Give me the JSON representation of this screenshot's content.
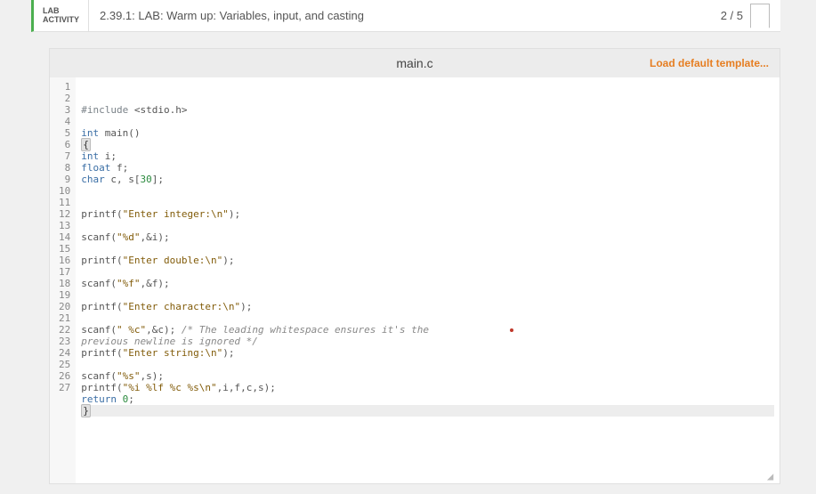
{
  "header": {
    "lab_label_line1": "LAB",
    "lab_label_line2": "ACTIVITY",
    "title": "2.39.1: LAB: Warm up: Variables, input, and casting",
    "score": "2 / 5"
  },
  "editor": {
    "filename": "main.c",
    "load_template_label": "Load default template...",
    "marker": {
      "line": 22,
      "col": 73
    },
    "lines": [
      {
        "n": 1,
        "tokens": [
          [
            "pp",
            "#include "
          ],
          [
            "pun",
            "<stdio.h>"
          ]
        ]
      },
      {
        "n": 2,
        "tokens": []
      },
      {
        "n": 3,
        "tokens": [
          [
            "typ",
            "int "
          ],
          [
            "fn",
            "main"
          ],
          [
            "pun",
            "()"
          ]
        ]
      },
      {
        "n": 4,
        "tokens": [
          [
            "brk",
            "{"
          ]
        ]
      },
      {
        "n": 5,
        "tokens": [
          [
            "typ",
            "int "
          ],
          [
            "fn",
            "i"
          ],
          [
            "pun",
            ";"
          ]
        ]
      },
      {
        "n": 6,
        "tokens": [
          [
            "typ",
            "float "
          ],
          [
            "fn",
            "f"
          ],
          [
            "pun",
            ";"
          ]
        ]
      },
      {
        "n": 7,
        "tokens": [
          [
            "typ",
            "char "
          ],
          [
            "fn",
            "c"
          ],
          [
            "pun",
            ", "
          ],
          [
            "fn",
            "s"
          ],
          [
            "pun",
            "["
          ],
          [
            "num",
            "30"
          ],
          [
            "pun",
            "];"
          ]
        ]
      },
      {
        "n": 8,
        "tokens": []
      },
      {
        "n": 9,
        "tokens": []
      },
      {
        "n": 10,
        "tokens": [
          [
            "fn",
            "printf"
          ],
          [
            "pun",
            "("
          ],
          [
            "str",
            "\"Enter integer:\\n\""
          ],
          [
            "pun",
            ");"
          ]
        ]
      },
      {
        "n": 11,
        "tokens": []
      },
      {
        "n": 12,
        "tokens": [
          [
            "fn",
            "scanf"
          ],
          [
            "pun",
            "("
          ],
          [
            "str",
            "\"%d\""
          ],
          [
            "pun",
            ",&"
          ],
          [
            "fn",
            "i"
          ],
          [
            "pun",
            ");"
          ]
        ]
      },
      {
        "n": 13,
        "tokens": []
      },
      {
        "n": 14,
        "tokens": [
          [
            "fn",
            "printf"
          ],
          [
            "pun",
            "("
          ],
          [
            "str",
            "\"Enter double:\\n\""
          ],
          [
            "pun",
            ");"
          ]
        ]
      },
      {
        "n": 15,
        "tokens": []
      },
      {
        "n": 16,
        "tokens": [
          [
            "fn",
            "scanf"
          ],
          [
            "pun",
            "("
          ],
          [
            "str",
            "\"%f\""
          ],
          [
            "pun",
            ",&"
          ],
          [
            "fn",
            "f"
          ],
          [
            "pun",
            ");"
          ]
        ]
      },
      {
        "n": 17,
        "tokens": []
      },
      {
        "n": 18,
        "tokens": [
          [
            "fn",
            "printf"
          ],
          [
            "pun",
            "("
          ],
          [
            "str",
            "\"Enter character:\\n\""
          ],
          [
            "pun",
            ");"
          ]
        ]
      },
      {
        "n": 19,
        "tokens": []
      },
      {
        "n": 20,
        "tokens": [
          [
            "fn",
            "scanf"
          ],
          [
            "pun",
            "("
          ],
          [
            "str",
            "\" %c\""
          ],
          [
            "pun",
            ",&"
          ],
          [
            "fn",
            "c"
          ],
          [
            "pun",
            "); "
          ],
          [
            "cmt",
            "/* The leading whitespace ensures it's the"
          ]
        ]
      },
      {
        "n": 21,
        "tokens": [
          [
            "cmt",
            "previous newline is ignored */"
          ]
        ]
      },
      {
        "n": 22,
        "tokens": [
          [
            "fn",
            "printf"
          ],
          [
            "pun",
            "("
          ],
          [
            "str",
            "\"Enter string:\\n\""
          ],
          [
            "pun",
            ");"
          ]
        ]
      },
      {
        "n": 23,
        "tokens": []
      },
      {
        "n": 24,
        "tokens": [
          [
            "fn",
            "scanf"
          ],
          [
            "pun",
            "("
          ],
          [
            "str",
            "\"%s\""
          ],
          [
            "pun",
            ","
          ],
          [
            "fn",
            "s"
          ],
          [
            "pun",
            ");"
          ]
        ]
      },
      {
        "n": 25,
        "tokens": [
          [
            "fn",
            "printf"
          ],
          [
            "pun",
            "("
          ],
          [
            "str",
            "\"%i %lf %c %s\\n\""
          ],
          [
            "pun",
            ","
          ],
          [
            "fn",
            "i"
          ],
          [
            "pun",
            ","
          ],
          [
            "fn",
            "f"
          ],
          [
            "pun",
            ","
          ],
          [
            "fn",
            "c"
          ],
          [
            "pun",
            ","
          ],
          [
            "fn",
            "s"
          ],
          [
            "pun",
            ");"
          ]
        ]
      },
      {
        "n": 26,
        "tokens": [
          [
            "kw",
            "return "
          ],
          [
            "num",
            "0"
          ],
          [
            "pun",
            ";"
          ]
        ]
      },
      {
        "n": 27,
        "hl": true,
        "tokens": [
          [
            "brk",
            "}"
          ]
        ]
      }
    ]
  }
}
